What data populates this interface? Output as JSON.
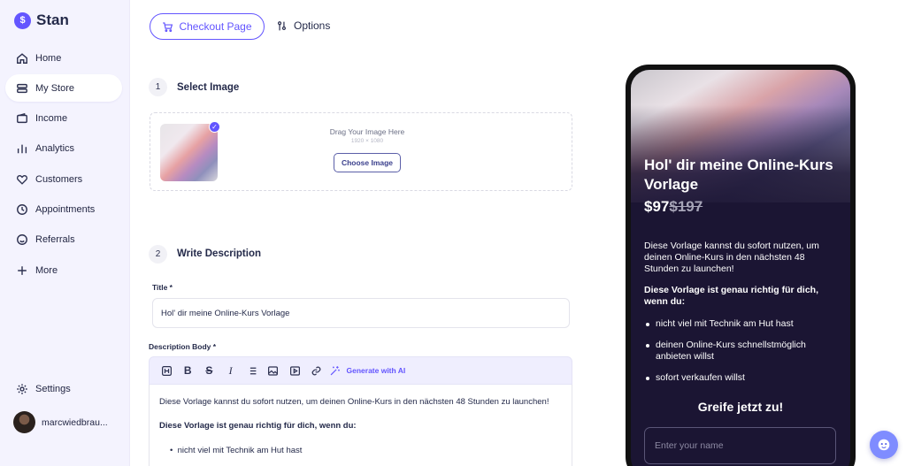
{
  "brand": {
    "name": "Stan",
    "logo_glyph": "$"
  },
  "sidebar": {
    "items": [
      {
        "label": "Home",
        "icon": "home-icon"
      },
      {
        "label": "My Store",
        "icon": "store-icon",
        "active": true
      },
      {
        "label": "Income",
        "icon": "wallet-icon"
      },
      {
        "label": "Analytics",
        "icon": "bar-chart-icon"
      },
      {
        "label": "Customers",
        "icon": "heart-icon"
      },
      {
        "label": "Appointments",
        "icon": "clock-icon"
      },
      {
        "label": "Referrals",
        "icon": "smile-icon"
      },
      {
        "label": "More",
        "icon": "plus-icon"
      }
    ],
    "settings_label": "Settings",
    "user_name": "marcwiedbrau..."
  },
  "tabs": {
    "checkout": "Checkout Page",
    "options": "Options"
  },
  "step1": {
    "num": "1",
    "title": "Select Image",
    "drag_text": "Drag Your Image Here",
    "size_hint": "1920 × 1080",
    "choose_btn": "Choose Image"
  },
  "step2": {
    "num": "2",
    "title": "Write Description",
    "title_label": "Title *",
    "title_value": "Hol' dir meine Online-Kurs Vorlage",
    "desc_label": "Description Body *",
    "gen_ai": "Generate with AI",
    "body_p1": "Diese Vorlage kannst du sofort nutzen, um deinen Online-Kurs in den nächsten 48 Stunden zu launchen!",
    "body_p2": "Diese Vorlage ist genau richtig für dich, wenn du:",
    "body_b1": "nicht viel mit Technik am Hut hast"
  },
  "preview": {
    "title": "Hol' dir meine Online-Kurs Vorlage",
    "price": "$97",
    "old_price": "$197",
    "desc": "Diese Vorlage kannst du sofort nutzen, um deinen Online-Kurs in den nächsten 48 Stunden zu launchen!",
    "bold": "Diese Vorlage ist genau richtig für dich, wenn du:",
    "bullets": [
      "nicht viel mit Technik am Hut hast",
      "deinen Online-Kurs schnellstmöglich anbieten willst",
      "sofort verkaufen willst"
    ],
    "cta": "Greife jetzt zu!",
    "name_placeholder": "Enter your name"
  },
  "colors": {
    "accent": "#6355ff",
    "sidebar_bg": "#f4f3fe",
    "preview_bg": "#1b1533"
  }
}
